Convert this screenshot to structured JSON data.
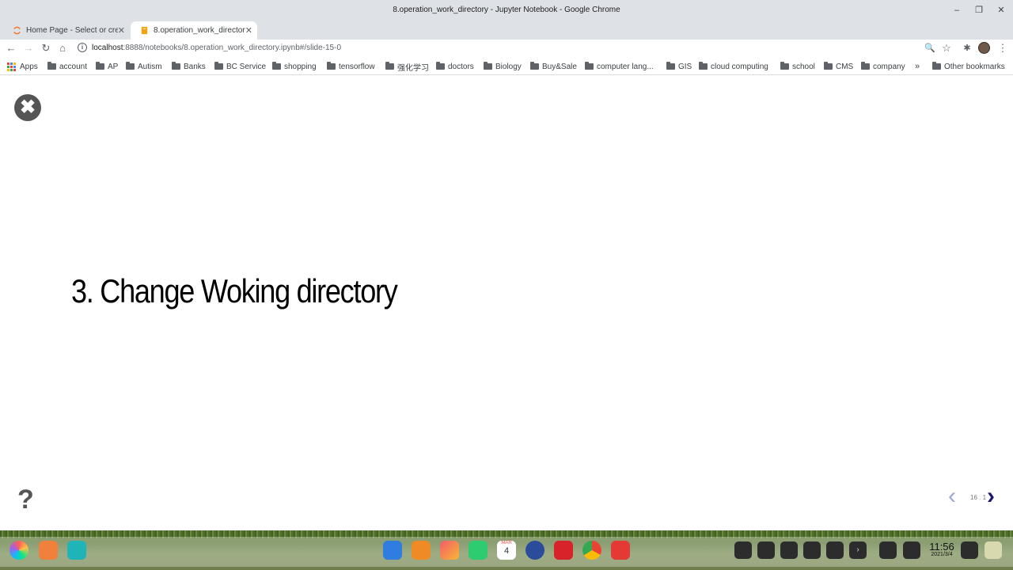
{
  "window": {
    "title": "8.operation_work_directory - Jupyter Notebook - Google Chrome",
    "minimize": "–",
    "restore": "❐",
    "close": "✕"
  },
  "tabs": [
    {
      "label": "Home Page - Select or create",
      "icon": "jupyter-icon",
      "close": "✕"
    },
    {
      "label": "8.operation_work_directory",
      "icon": "notebook-icon",
      "close": "✕"
    }
  ],
  "newtab": "+",
  "toolbar": {
    "back": "←",
    "forward": "→",
    "reload": "↻",
    "home": "⌂",
    "info": "i",
    "url_host": "localhost",
    "url_path": ":8888/notebooks/8.operation_work_directory.ipynb#/slide-15-0",
    "zoom": "🔍",
    "star": "☆",
    "extensions": "✱",
    "menu": "⋮"
  },
  "bookmarks": {
    "apps_label": "Apps",
    "items": [
      "account",
      "AP",
      "Autism",
      "Banks",
      "BC Service",
      "shopping",
      "tensorflow",
      "强化学习",
      "doctors",
      "Biology",
      "Buy&Sale",
      "computer lang...",
      "GIS",
      "cloud computing",
      "school",
      "CMS",
      "company"
    ],
    "overflow": "»",
    "other": "Other bookmarks"
  },
  "slide": {
    "close_symbol": "✖",
    "heading": "3. Change Woking directory",
    "help_symbol": "?",
    "prev_symbol": "‹",
    "next_symbol": "›",
    "slide_number": "16 . 1"
  },
  "taskbar": {
    "apps": [
      "launcher-icon",
      "multitask-icon",
      "files-icon",
      "app-store-icon",
      "box-icon",
      "photos-icon",
      "music-icon",
      "calendar-icon",
      "settings-icon",
      "terminal-icon",
      "chrome-icon",
      "record-icon"
    ],
    "calendar_month": "MAR",
    "calendar_day": "4",
    "tray_next": "›",
    "time": "11:56",
    "date": "2021/3/4"
  }
}
